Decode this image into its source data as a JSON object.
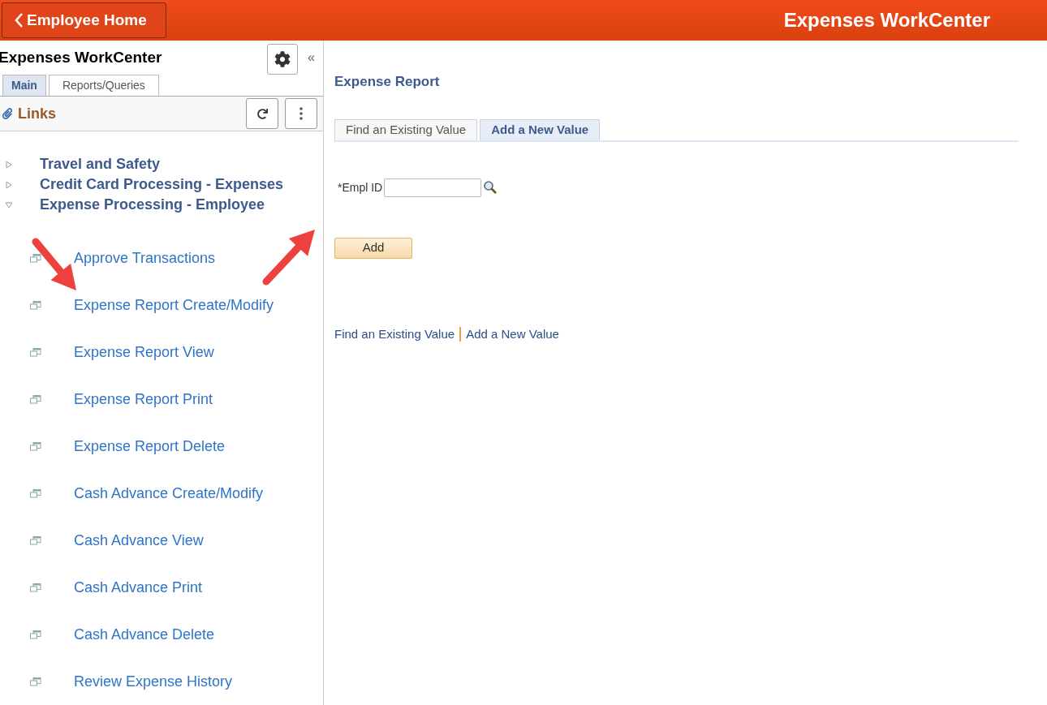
{
  "header": {
    "back_button": "Employee Home",
    "title": "Expenses WorkCenter"
  },
  "sidebar": {
    "title": "Expenses WorkCenter",
    "collapse": "«",
    "tabs": [
      {
        "label": "Main",
        "selected": true
      },
      {
        "label": "Reports/Queries",
        "selected": false
      }
    ],
    "links_title": "Links",
    "tree": [
      {
        "label": "Travel and Safety",
        "expanded": false
      },
      {
        "label": "Credit Card Processing - Expenses",
        "expanded": false
      },
      {
        "label": "Expense Processing - Employee",
        "expanded": true,
        "children": [
          {
            "label": "Approve Transactions"
          },
          {
            "label": "Expense Report Create/Modify"
          },
          {
            "label": "Expense Report View"
          },
          {
            "label": "Expense Report Print"
          },
          {
            "label": "Expense Report Delete"
          },
          {
            "label": "Cash Advance Create/Modify"
          },
          {
            "label": "Cash Advance View"
          },
          {
            "label": "Cash Advance Print"
          },
          {
            "label": "Cash Advance Delete"
          },
          {
            "label": "Review Expense History"
          }
        ]
      }
    ]
  },
  "main": {
    "title": "Expense Report",
    "tabs": [
      {
        "label": "Find an Existing Value",
        "selected": false
      },
      {
        "label": "Add a New Value",
        "selected": true
      }
    ],
    "field": {
      "label": "*Empl ID"
    },
    "add_button": "Add",
    "footer_links": [
      {
        "label": "Find an Existing Value"
      },
      {
        "label": "Add a New Value"
      }
    ]
  }
}
